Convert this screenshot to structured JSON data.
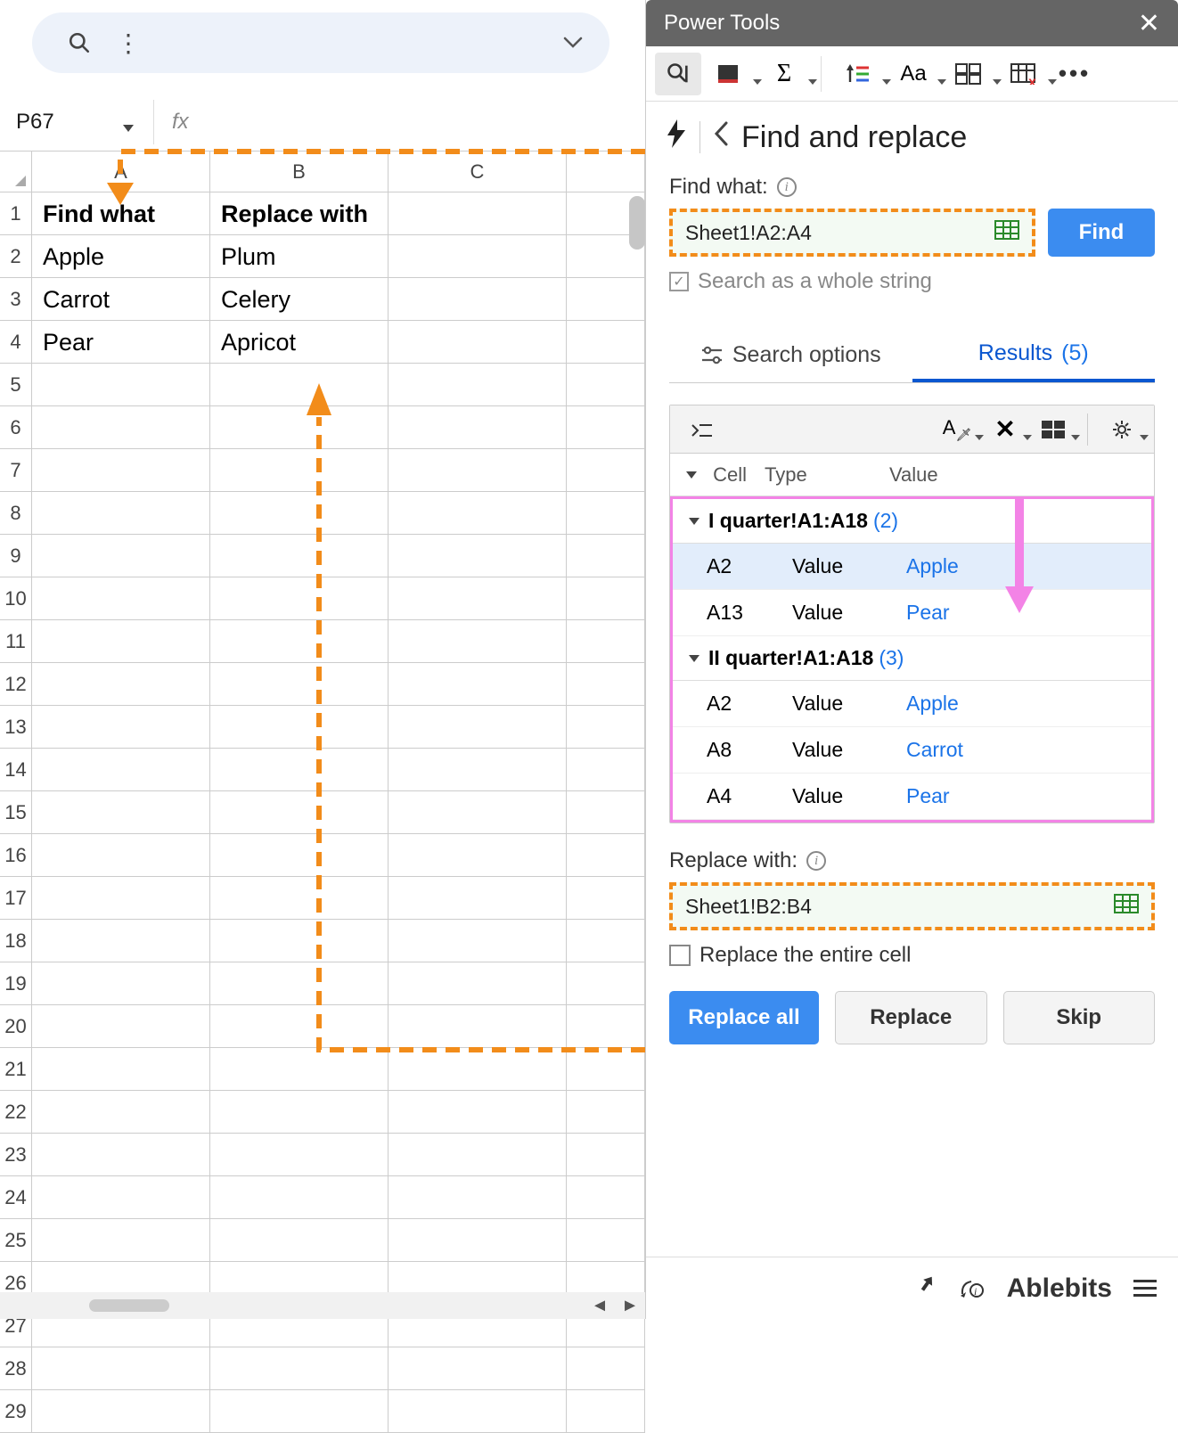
{
  "spreadsheet": {
    "name_box": "P67",
    "columns": [
      "A",
      "B",
      "C"
    ],
    "row_count": 29,
    "header_row": {
      "a": "Find what",
      "b": "Replace with"
    },
    "data": [
      {
        "a": "Apple",
        "b": "Plum"
      },
      {
        "a": "Carrot",
        "b": "Celery"
      },
      {
        "a": "Pear",
        "b": "Apricot"
      }
    ]
  },
  "panel": {
    "title": "Power Tools",
    "page_title": "Find and replace",
    "find_label": "Find what:",
    "find_value": "Sheet1!A2:A4",
    "find_button": "Find",
    "search_whole": "Search as a whole string",
    "tabs": {
      "options": "Search options",
      "results": "Results",
      "results_count": "(5)"
    },
    "results_header": {
      "cell": "Cell",
      "type": "Type",
      "value": "Value"
    },
    "groups": [
      {
        "name": "I quarter!A1:A18",
        "count": "(2)",
        "rows": [
          {
            "cell": "A2",
            "type": "Value",
            "value": "Apple",
            "highlight": true
          },
          {
            "cell": "A13",
            "type": "Value",
            "value": "Pear"
          }
        ]
      },
      {
        "name": "II quarter!A1:A18",
        "count": "(3)",
        "rows": [
          {
            "cell": "A2",
            "type": "Value",
            "value": "Apple"
          },
          {
            "cell": "A8",
            "type": "Value",
            "value": "Carrot"
          },
          {
            "cell": "A4",
            "type": "Value",
            "value": "Pear"
          }
        ]
      }
    ],
    "replace_label": "Replace with:",
    "replace_value": "Sheet1!B2:B4",
    "replace_entire": "Replace the entire cell",
    "btn_replace_all": "Replace all",
    "btn_replace": "Replace",
    "btn_skip": "Skip",
    "brand": "Ablebits"
  }
}
